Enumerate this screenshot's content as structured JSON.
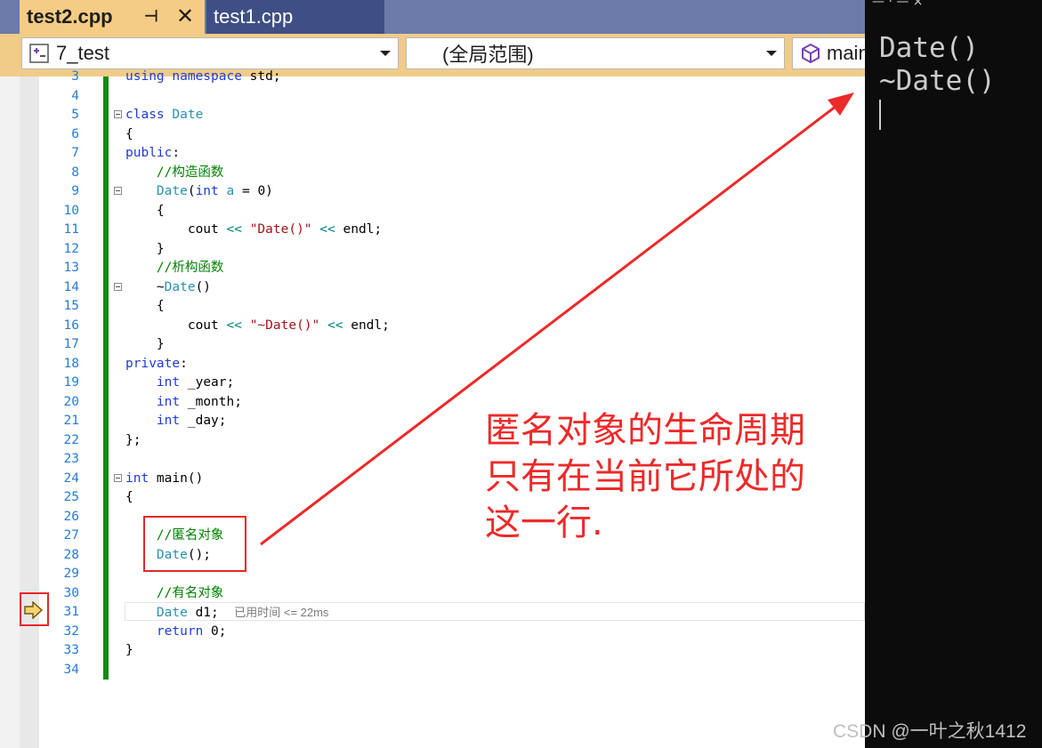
{
  "tabs": [
    {
      "label": "test2.cpp",
      "active": true
    },
    {
      "label": "test1.cpp",
      "active": false
    }
  ],
  "nav": {
    "project": "7_test",
    "scope": "(全局范围)",
    "member": "main"
  },
  "code_lines": [
    {
      "n": "3",
      "html": "<span class=\"kw\">using namespace</span> std;"
    },
    {
      "n": "4",
      "html": ""
    },
    {
      "n": "5",
      "html": "<span class=\"kw\">class</span> <span class=\"ty\">Date</span>",
      "fold": true
    },
    {
      "n": "6",
      "html": "{"
    },
    {
      "n": "7",
      "html": "<span class=\"kw\">public</span>:"
    },
    {
      "n": "8",
      "html": "    <span class=\"cm\">//构造函数</span>"
    },
    {
      "n": "9",
      "html": "    <span class=\"ty\">Date</span>(<span class=\"kw\">int</span> <span class=\"ty\">a</span> = 0)",
      "fold": true
    },
    {
      "n": "10",
      "html": "    {"
    },
    {
      "n": "11",
      "html": "        cout <span class=\"op\">&lt;&lt;</span> <span class=\"st\">\"Date()\"</span> <span class=\"op\">&lt;&lt;</span> endl;"
    },
    {
      "n": "12",
      "html": "    }"
    },
    {
      "n": "13",
      "html": "    <span class=\"cm\">//析构函数</span>"
    },
    {
      "n": "14",
      "html": "    ~<span class=\"ty\">Date</span>()",
      "fold": true
    },
    {
      "n": "15",
      "html": "    {"
    },
    {
      "n": "16",
      "html": "        cout <span class=\"op\">&lt;&lt;</span> <span class=\"st\">\"~Date()\"</span> <span class=\"op\">&lt;&lt;</span> endl;"
    },
    {
      "n": "17",
      "html": "    }"
    },
    {
      "n": "18",
      "html": "<span class=\"kw\">private</span>:"
    },
    {
      "n": "19",
      "html": "    <span class=\"kw\">int</span> _year;"
    },
    {
      "n": "20",
      "html": "    <span class=\"kw\">int</span> _month;"
    },
    {
      "n": "21",
      "html": "    <span class=\"kw\">int</span> _day;"
    },
    {
      "n": "22",
      "html": "};"
    },
    {
      "n": "23",
      "html": ""
    },
    {
      "n": "24",
      "html": "<span class=\"kw\">int</span> main()",
      "fold": true
    },
    {
      "n": "25",
      "html": "{"
    },
    {
      "n": "26",
      "html": ""
    },
    {
      "n": "27",
      "html": "    <span class=\"cm\">//匿名对象</span>"
    },
    {
      "n": "28",
      "html": "    <span class=\"ty\">Date</span>();"
    },
    {
      "n": "29",
      "html": ""
    },
    {
      "n": "30",
      "html": "    <span class=\"cm\">//有名对象</span>"
    },
    {
      "n": "31",
      "html": "    <span class=\"ty\">Date</span> d1;  <span class=\"hint\">已用时间 &lt;= 22ms</span>"
    },
    {
      "n": "32",
      "html": "    <span class=\"kw\">return</span> 0;"
    },
    {
      "n": "33",
      "html": "}"
    },
    {
      "n": "34",
      "html": ""
    }
  ],
  "annotation": [
    "匿名对象的生命周期",
    "只有在当前它所处的",
    "这一行."
  ],
  "console": {
    "top_fragment": "— · — ×",
    "lines": [
      "Date()",
      "~Date()"
    ]
  },
  "watermark": "CSDN @一叶之秋1412",
  "colors": {
    "annotation": "#ec2a2a",
    "tab_active": "#f5cc84",
    "tab_inactive": "#3e4f85",
    "console_bg": "#0c0c0c",
    "change_bar": "#138a13"
  }
}
